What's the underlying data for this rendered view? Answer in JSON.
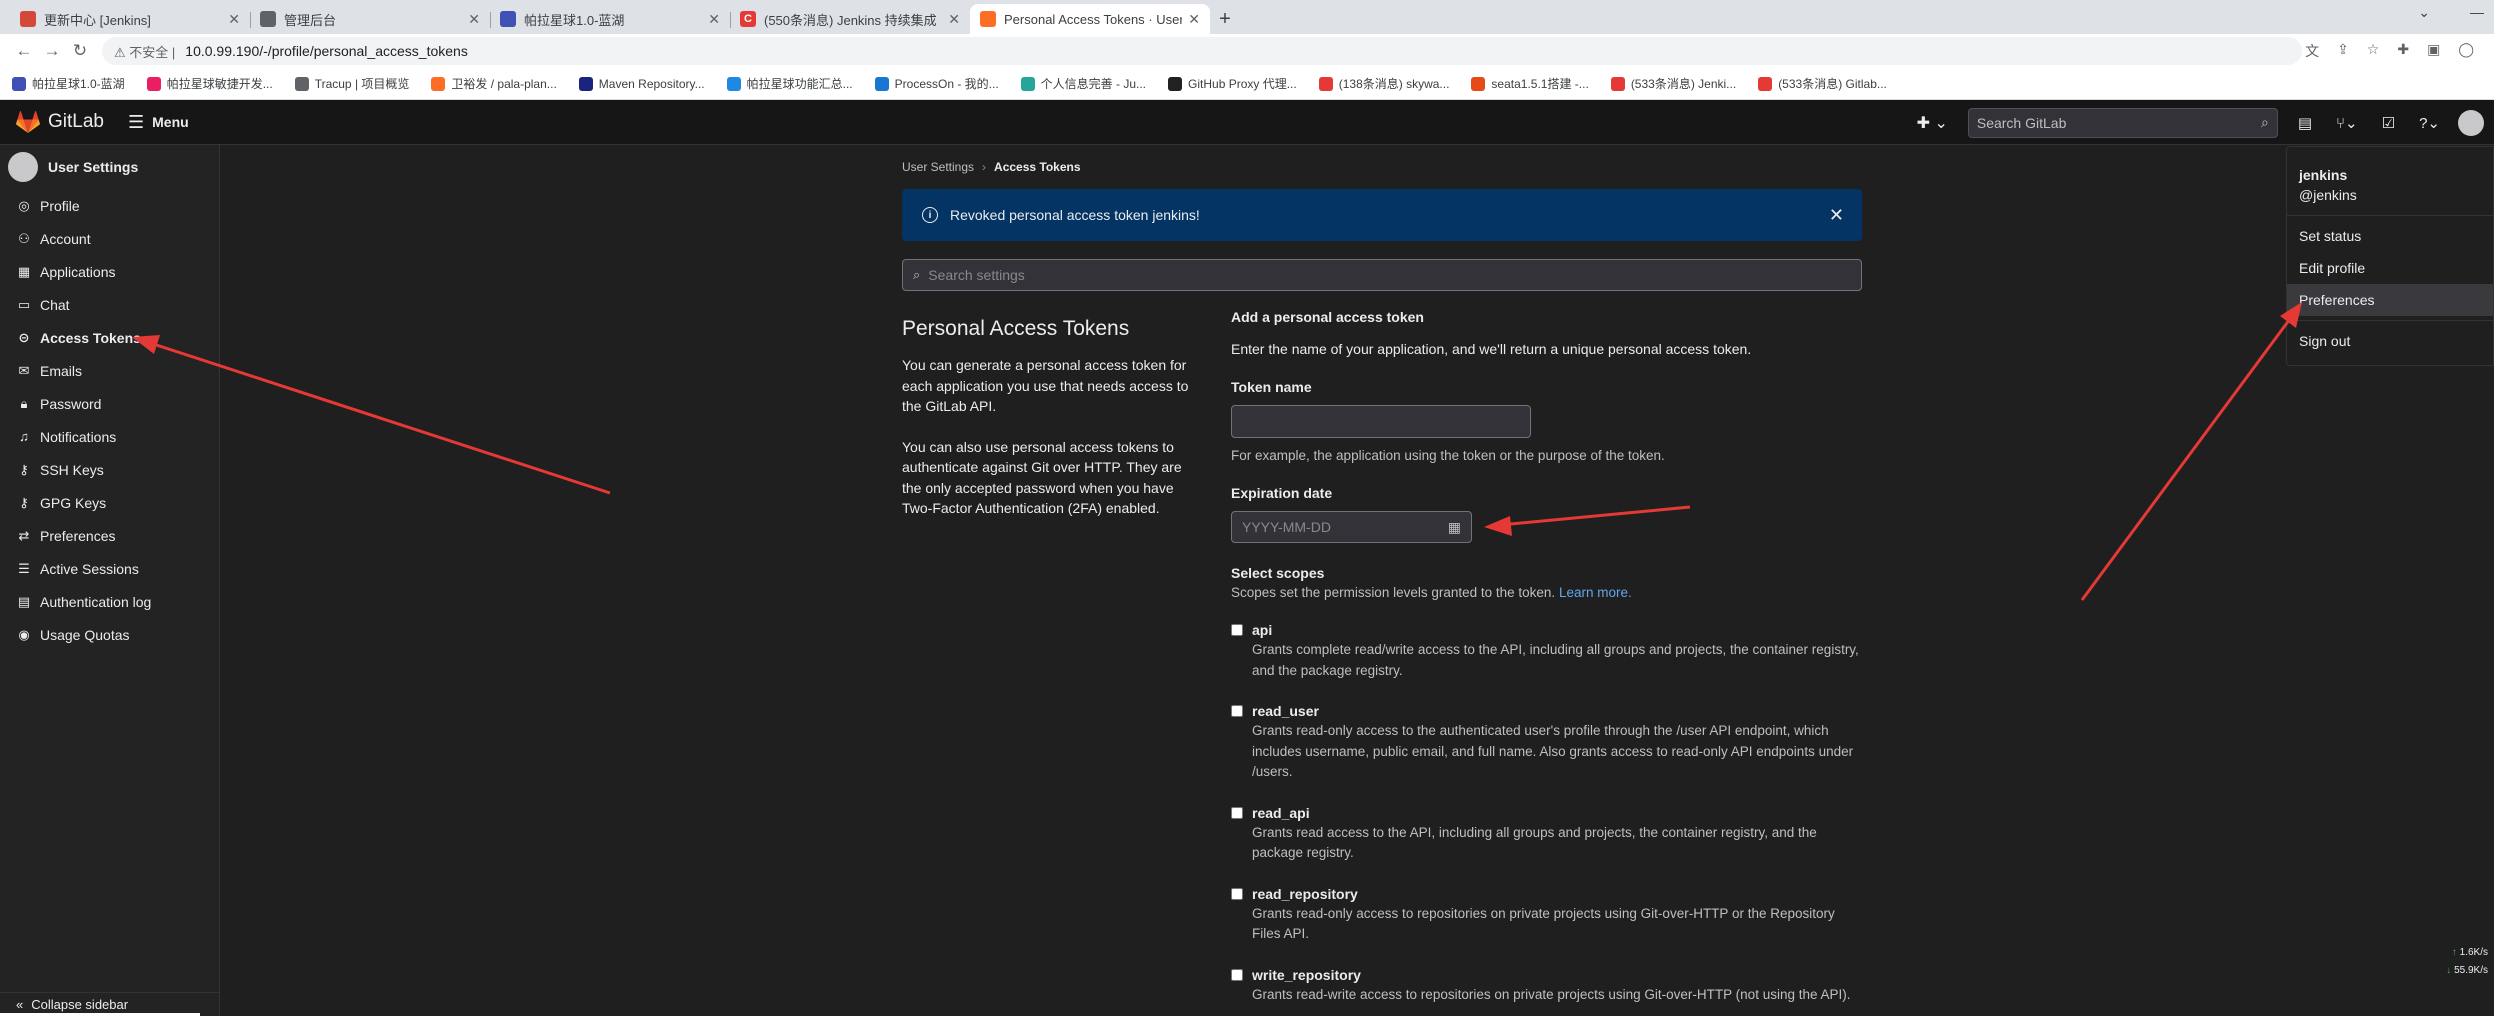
{
  "browser": {
    "tabs": [
      {
        "label": "更新中心 [Jenkins]",
        "color": "#d24939",
        "letter": ""
      },
      {
        "label": "管理后台",
        "color": "#5f6368",
        "letter": ""
      },
      {
        "label": "帕拉星球1.0-蓝湖",
        "color": "#3f51b5",
        "letter": ""
      },
      {
        "label": "(550条消息) Jenkins 持续集成",
        "color": "#e53935",
        "letter": "C"
      },
      {
        "label": "Personal Access Tokens · User",
        "color": "#fc6d26",
        "letter": ""
      }
    ],
    "url": "10.0.99.190/-/profile/personal_access_tokens",
    "insecure_label": "不安全",
    "bookmarks": [
      {
        "label": "帕拉星球1.0-蓝湖",
        "color": "#3f51b5"
      },
      {
        "label": "帕拉星球敏捷开发...",
        "color": "#e91e63"
      },
      {
        "label": "Tracup | 项目概览",
        "color": "#5f6368"
      },
      {
        "label": "卫裕发 / pala-plan...",
        "color": "#fc6d26"
      },
      {
        "label": "Maven Repository...",
        "color": "#1a237e"
      },
      {
        "label": "帕拉星球功能汇总...",
        "color": "#1e88e5"
      },
      {
        "label": "ProcessOn - 我的...",
        "color": "#1976d2"
      },
      {
        "label": "个人信息完善 - Ju...",
        "color": "#26a69a"
      },
      {
        "label": "GitHub Proxy 代理...",
        "color": "#212121"
      },
      {
        "label": "(138条消息) skywa...",
        "color": "#e53935"
      },
      {
        "label": "seata1.5.1搭建 -...",
        "color": "#e64a19"
      },
      {
        "label": "(533条消息) Jenki...",
        "color": "#e53935"
      },
      {
        "label": "(533条消息) Gitlab...",
        "color": "#e53935"
      }
    ]
  },
  "header": {
    "brand": "GitLab",
    "menu_label": "Menu",
    "search_placeholder": "Search GitLab"
  },
  "sidebar": {
    "title": "User Settings",
    "items": [
      {
        "label": "Profile",
        "icon": "user-icon"
      },
      {
        "label": "Account",
        "icon": "account-icon"
      },
      {
        "label": "Applications",
        "icon": "applications-icon"
      },
      {
        "label": "Chat",
        "icon": "chat-icon"
      },
      {
        "label": "Access Tokens",
        "icon": "token-icon"
      },
      {
        "label": "Emails",
        "icon": "mail-icon"
      },
      {
        "label": "Password",
        "icon": "lock-icon"
      },
      {
        "label": "Notifications",
        "icon": "bell-icon"
      },
      {
        "label": "SSH Keys",
        "icon": "key-icon"
      },
      {
        "label": "GPG Keys",
        "icon": "key-icon"
      },
      {
        "label": "Preferences",
        "icon": "preferences-icon"
      },
      {
        "label": "Active Sessions",
        "icon": "sessions-icon"
      },
      {
        "label": "Authentication log",
        "icon": "log-icon"
      },
      {
        "label": "Usage Quotas",
        "icon": "quota-icon"
      }
    ],
    "collapse_label": "Collapse sidebar"
  },
  "main": {
    "breadcrumb": {
      "parent": "User Settings",
      "current": "Access Tokens"
    },
    "alert": "Revoked personal access token jenkins!",
    "settings_search_placeholder": "Search settings",
    "left": {
      "title": "Personal Access Tokens",
      "p1": "You can generate a personal access token for each application you use that needs access to the GitLab API.",
      "p2": "You can also use personal access tokens to authenticate against Git over HTTP. They are the only accepted password when you have Two-Factor Authentication (2FA) enabled."
    },
    "form": {
      "heading": "Add a personal access token",
      "intro": "Enter the name of your application, and we'll return a unique personal access token.",
      "token_name_label": "Token name",
      "token_name_value": "",
      "token_name_help": "For example, the application using the token or the purpose of the token.",
      "expiration_label": "Expiration date",
      "expiration_placeholder": "YYYY-MM-DD",
      "scopes_label": "Select scopes",
      "scopes_desc": "Scopes set the permission levels granted to the token.",
      "learn_more": "Learn more.",
      "scopes": [
        {
          "name": "api",
          "desc": "Grants complete read/write access to the API, including all groups and projects, the container registry, and the package registry.",
          "checked": false
        },
        {
          "name": "read_user",
          "desc": "Grants read-only access to the authenticated user's profile through the /user API endpoint, which includes username, public email, and full name. Also grants access to read-only API endpoints under /users.",
          "checked": false
        },
        {
          "name": "read_api",
          "desc": "Grants read access to the API, including all groups and projects, the container registry, and the package registry.",
          "checked": false
        },
        {
          "name": "read_repository",
          "desc": "Grants read-only access to repositories on private projects using Git-over-HTTP or the Repository Files API.",
          "checked": false
        },
        {
          "name": "write_repository",
          "desc": "Grants read-write access to repositories on private projects using Git-over-HTTP (not using the API).",
          "checked": false
        }
      ]
    }
  },
  "user_dropdown": {
    "name": "jenkins",
    "username": "@jenkins",
    "items": [
      "Set status",
      "Edit profile",
      "Preferences",
      "Sign out"
    ]
  },
  "net_widget": {
    "up": "1.6",
    "up_unit": "K/s",
    "down": "55.9",
    "down_unit": "K/s"
  }
}
